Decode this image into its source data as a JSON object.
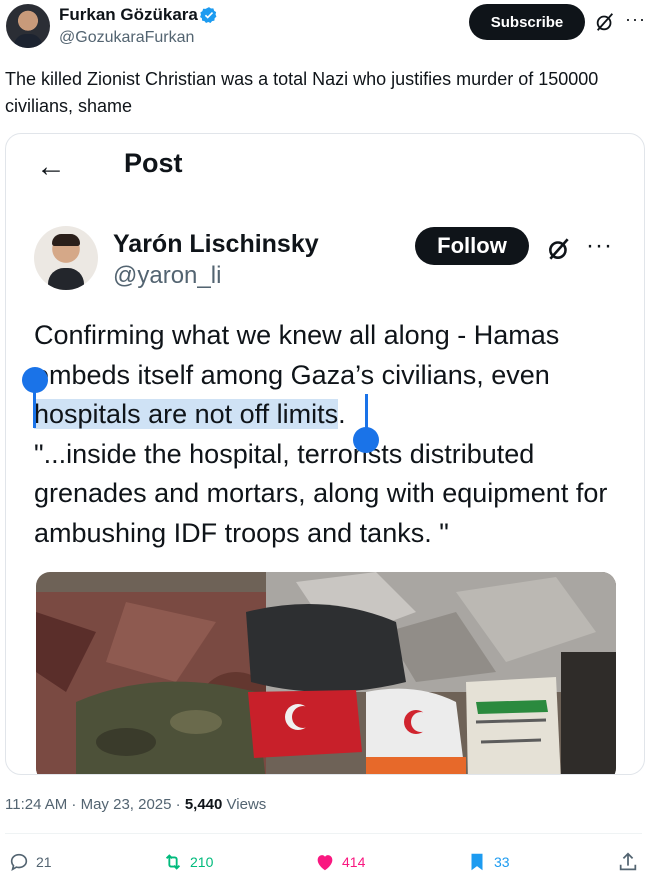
{
  "author": {
    "name": "Furkan Gözükara",
    "handle": "@GozukaraFurkan"
  },
  "header": {
    "subscribe_label": "Subscribe",
    "more_label": "···"
  },
  "tweet": {
    "text": "The killed Zionist Christian was a total Nazi who justifies murder of 150000 civilians, shame"
  },
  "quoted": {
    "back_icon": "←",
    "title": "Post",
    "name": "Yarón Lischinsky",
    "handle": "@yaron_li",
    "follow_label": "Follow",
    "more_label": "···",
    "text_part1": "Confirming what we knew all along - Hamas embeds itself among Gaza’s civilians, even ",
    "text_highlight": "hospitals are not off limits",
    "text_part2": ".",
    "text_quote": "\"...inside the hospital, terrorists distributed grenades and mortars, along with equipment for ambushing IDF troops and tanks. \""
  },
  "meta": {
    "time_date": "11:24 AM · May 23, 2025 · ",
    "views_count": "5,440",
    "views_label": " Views"
  },
  "actions": {
    "replies": "21",
    "reposts": "210",
    "likes": "414",
    "bookmarks": "33"
  },
  "colors": {
    "repost": "#00ba7c",
    "like": "#f91880",
    "bookmark": "#1d9bf0",
    "verified": "#1d9bf0",
    "selection": "#1a73e8"
  }
}
